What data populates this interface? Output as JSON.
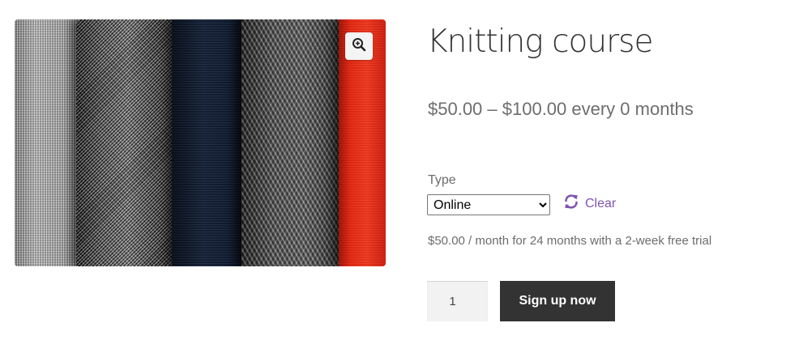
{
  "product": {
    "title": "Knitting course",
    "price_range": "$50.00 – $100.00 every 0 months",
    "image_alt": "Folded knitted fabrics"
  },
  "variations": {
    "type_label": "Type",
    "type_selected": "Online",
    "clear_label": "Clear",
    "description": "$50.00 / month for 24 months with a 2-week free trial"
  },
  "cart": {
    "quantity": "1",
    "submit_label": "Sign up now"
  },
  "icons": {
    "zoom": "zoom-in-icon",
    "clear": "refresh-icon"
  },
  "colors": {
    "accent": "#7f54b3",
    "button_bg": "#333333",
    "button_text": "#ffffff",
    "text": "#6d6d6d"
  }
}
